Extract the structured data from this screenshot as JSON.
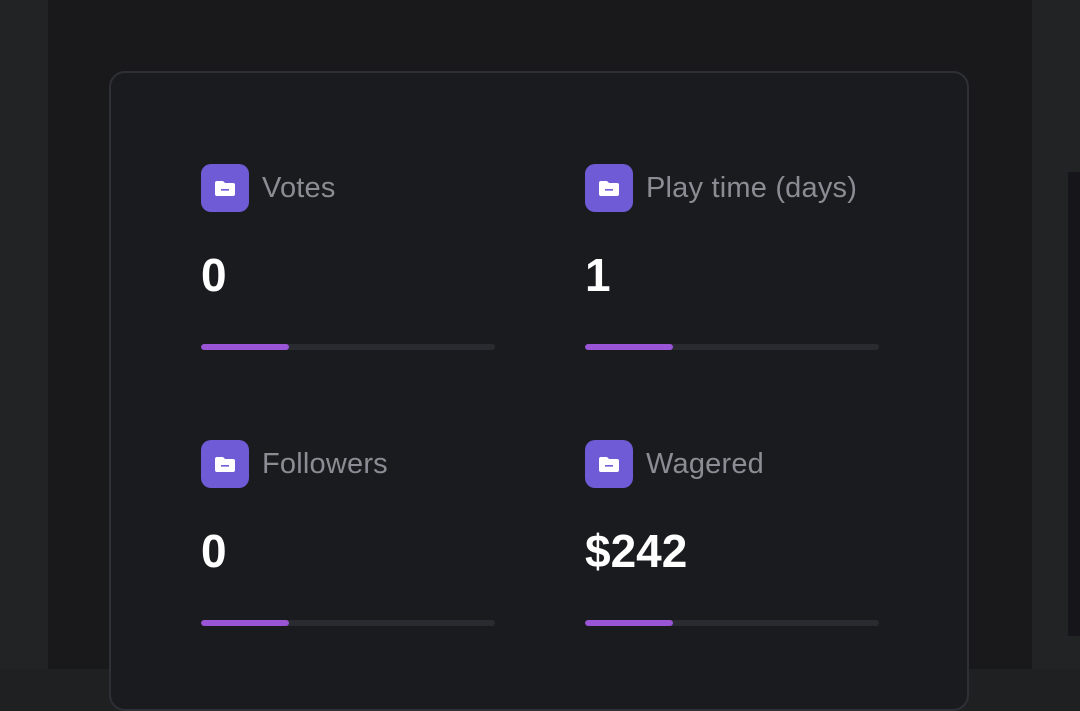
{
  "stats": [
    {
      "label": "Votes",
      "value": "0",
      "progress": 0.3
    },
    {
      "label": "Play time (days)",
      "value": "1",
      "progress": 0.3
    },
    {
      "label": "Followers",
      "value": "0",
      "progress": 0.3
    },
    {
      "label": "Wagered",
      "value": "$242",
      "progress": 0.3
    }
  ],
  "colors": {
    "icon_bg": "#6f5bd5",
    "progress_fill": "#9a55d6",
    "progress_track": "#2a2b31",
    "label_text": "#8b8c94",
    "value_text": "#ffffff"
  },
  "icons": {
    "stat_icon": "folder-icon"
  }
}
